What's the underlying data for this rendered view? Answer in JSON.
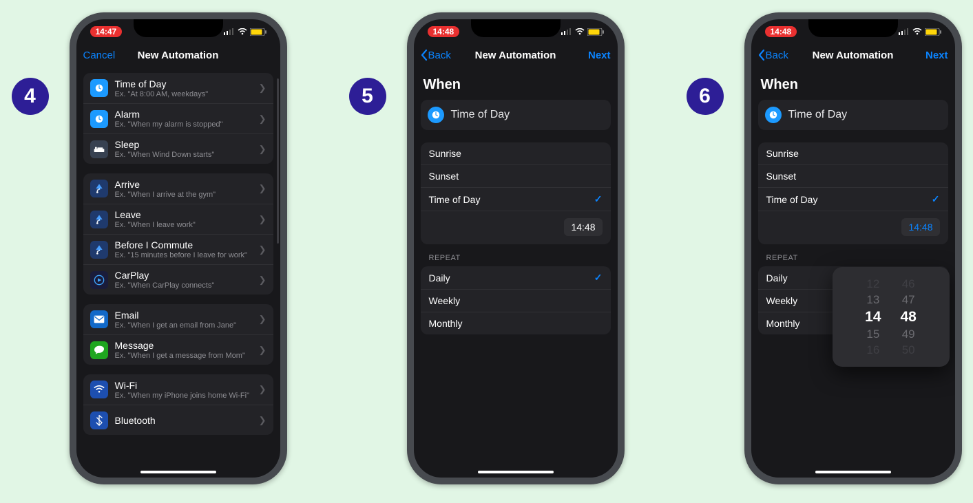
{
  "steps": [
    "4",
    "5",
    "6"
  ],
  "screen1": {
    "status_time": "14:47",
    "nav": {
      "left": "Cancel",
      "title": "New Automation",
      "right": ""
    },
    "groups": [
      [
        {
          "title": "Time of Day",
          "sub": "Ex. \"At 8:00 AM, weekdays\"",
          "icon": "clock"
        },
        {
          "title": "Alarm",
          "sub": "Ex. \"When my alarm is stopped\"",
          "icon": "clock"
        },
        {
          "title": "Sleep",
          "sub": "Ex. \"When Wind Down starts\"",
          "icon": "sleep"
        }
      ],
      [
        {
          "title": "Arrive",
          "sub": "Ex. \"When I arrive at the gym\"",
          "icon": "arrive"
        },
        {
          "title": "Leave",
          "sub": "Ex. \"When I leave work\"",
          "icon": "leave"
        },
        {
          "title": "Before I Commute",
          "sub": "Ex. \"15 minutes before I leave for work\"",
          "icon": "commute"
        },
        {
          "title": "CarPlay",
          "sub": "Ex. \"When CarPlay connects\"",
          "icon": "carplay"
        }
      ],
      [
        {
          "title": "Email",
          "sub": "Ex. \"When I get an email from Jane\"",
          "icon": "email"
        },
        {
          "title": "Message",
          "sub": "Ex. \"When I get a message from Mom\"",
          "icon": "message"
        }
      ],
      [
        {
          "title": "Wi-Fi",
          "sub": "Ex. \"When my iPhone joins home Wi-Fi\"",
          "icon": "wifi"
        },
        {
          "title": "Bluetooth",
          "sub": "",
          "icon": "bt"
        }
      ]
    ]
  },
  "screen2": {
    "status_time": "14:48",
    "nav": {
      "back": "Back",
      "title": "New Automation",
      "next": "Next"
    },
    "when_heading": "When",
    "when_row": "Time of Day",
    "time_value": "14:48",
    "time_options": [
      {
        "label": "Sunrise",
        "selected": false
      },
      {
        "label": "Sunset",
        "selected": false
      },
      {
        "label": "Time of Day",
        "selected": true
      }
    ],
    "repeat_label": "REPEAT",
    "repeat_options": [
      {
        "label": "Daily",
        "selected": true
      },
      {
        "label": "Weekly",
        "selected": false
      },
      {
        "label": "Monthly",
        "selected": false
      }
    ]
  },
  "screen3": {
    "status_time": "14:48",
    "nav": {
      "back": "Back",
      "title": "New Automation",
      "next": "Next"
    },
    "when_heading": "When",
    "when_row": "Time of Day",
    "time_value": "14:48",
    "time_options": [
      {
        "label": "Sunrise",
        "selected": false
      },
      {
        "label": "Sunset",
        "selected": false
      },
      {
        "label": "Time of Day",
        "selected": true
      }
    ],
    "repeat_label": "REPEAT",
    "repeat_options": [
      {
        "label": "Daily",
        "selected": true
      },
      {
        "label": "Weekly",
        "selected": false
      },
      {
        "label": "Monthly",
        "selected": false
      }
    ],
    "picker": {
      "hours": [
        "12",
        "13",
        "14",
        "15",
        "16"
      ],
      "minutes": [
        "46",
        "47",
        "48",
        "49",
        "50"
      ]
    }
  }
}
